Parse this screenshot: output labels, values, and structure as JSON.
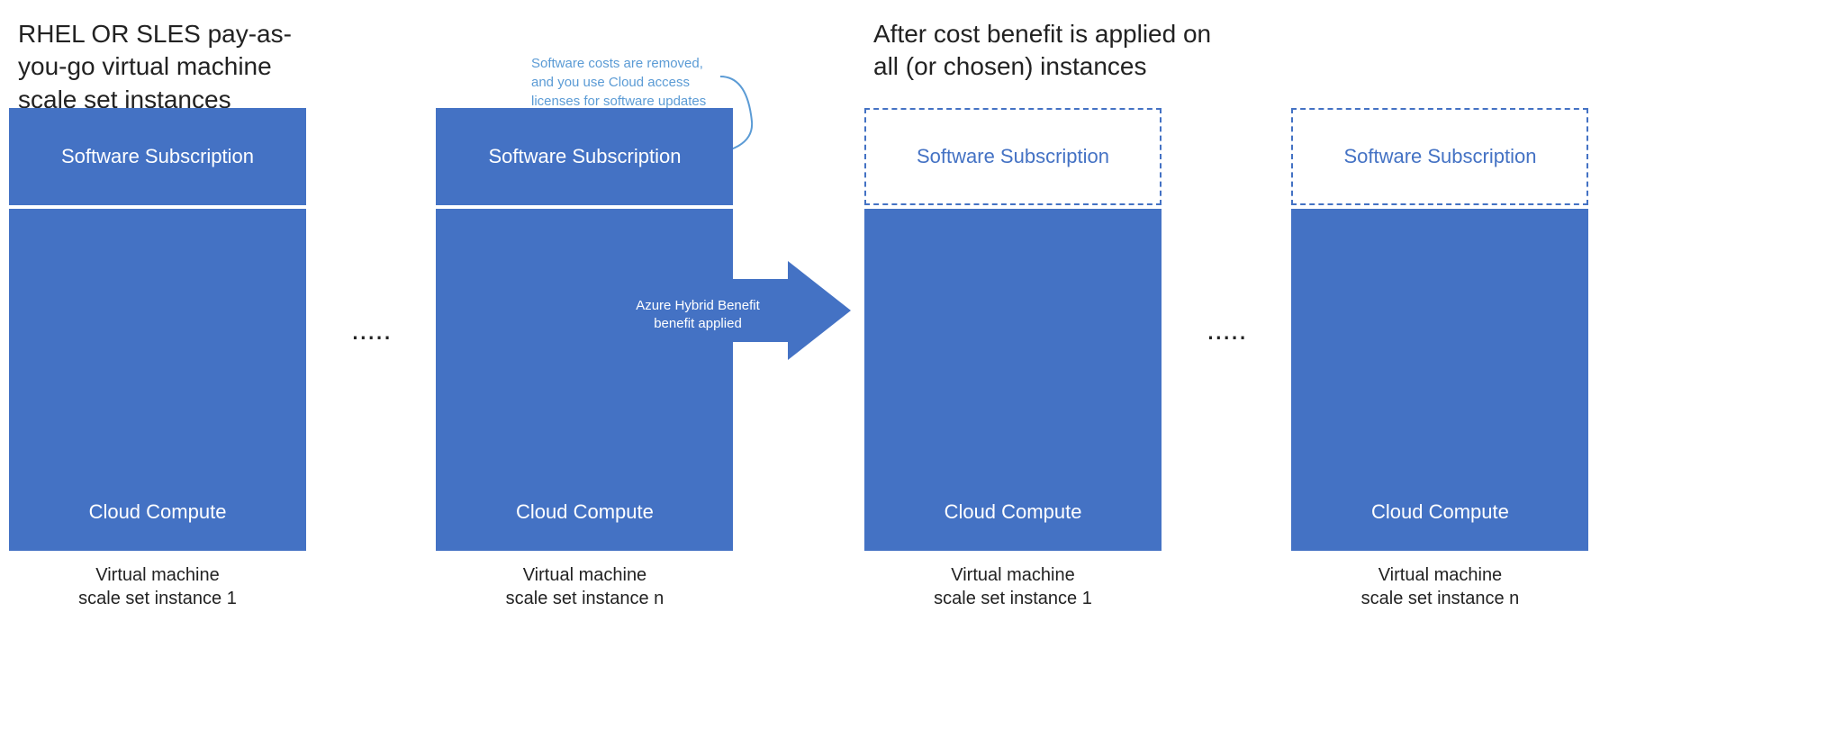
{
  "diagram": {
    "left_title": "RHEL OR SLES pay-as-you-go virtual machine scale set instances",
    "right_title": "After cost benefit is applied on all (or chosen) instances",
    "annotation_text": "Software costs are removed, and you use Cloud access licenses for software updates from RHEL or SUSE.",
    "arrow_label": "Azure Hybrid Benefit benefit applied",
    "left_columns": [
      {
        "software_label": "Software Subscription",
        "compute_label": "Cloud Compute",
        "vm_label_line1": "Virtual machine",
        "vm_label_line2": "scale set instance 1",
        "dashed": false
      },
      {
        "software_label": "Software Subscription",
        "compute_label": "Cloud Compute",
        "vm_label_line1": "Virtual machine",
        "vm_label_line2": "scale set instance n",
        "dashed": false
      }
    ],
    "right_columns": [
      {
        "software_label": "Software Subscription",
        "compute_label": "Cloud Compute",
        "vm_label_line1": "Virtual machine",
        "vm_label_line2": "scale set instance 1",
        "dashed": true
      },
      {
        "software_label": "Software Subscription",
        "compute_label": "Cloud Compute",
        "vm_label_line1": "Virtual machine",
        "vm_label_line2": "scale set instance n",
        "dashed": true
      }
    ],
    "ellipsis": ".....",
    "colors": {
      "blue_fill": "#4472c4",
      "white": "#ffffff",
      "text_dark": "#222222",
      "annotation_blue": "#5b9bd5"
    }
  }
}
